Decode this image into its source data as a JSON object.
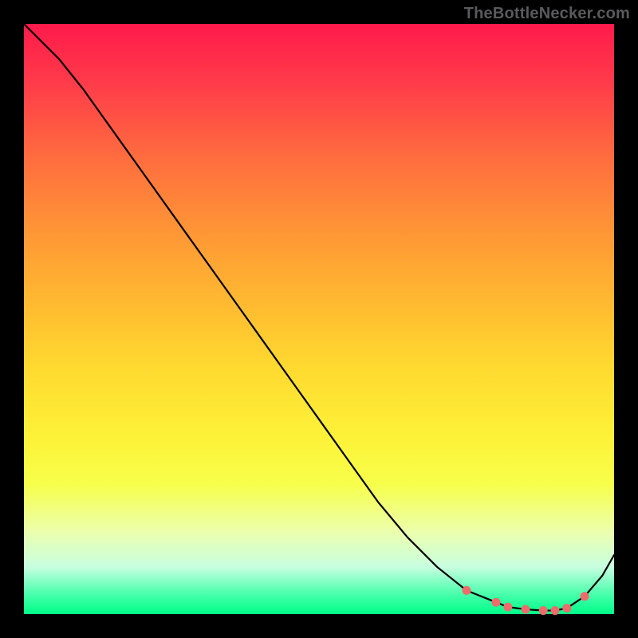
{
  "watermark": "TheBottleNecker.com",
  "chart_data": {
    "type": "line",
    "title": "",
    "xlabel": "",
    "ylabel": "",
    "xlim": [
      0,
      100
    ],
    "ylim": [
      0,
      100
    ],
    "x": [
      0,
      6,
      10,
      15,
      20,
      25,
      30,
      35,
      40,
      45,
      50,
      55,
      60,
      65,
      70,
      75,
      80,
      82,
      85,
      88,
      90,
      92,
      95,
      98,
      100
    ],
    "values": [
      100,
      94,
      89,
      82,
      75,
      68,
      61,
      54,
      47,
      40,
      33,
      26,
      19,
      13,
      8,
      4,
      2,
      1.2,
      0.8,
      0.6,
      0.6,
      1.0,
      3.0,
      6.5,
      10
    ],
    "marker_indices": [
      15,
      16,
      17,
      18,
      19,
      20,
      21,
      22
    ],
    "colors": {
      "curve": "#000000",
      "markers": "#ef6b6b"
    }
  }
}
